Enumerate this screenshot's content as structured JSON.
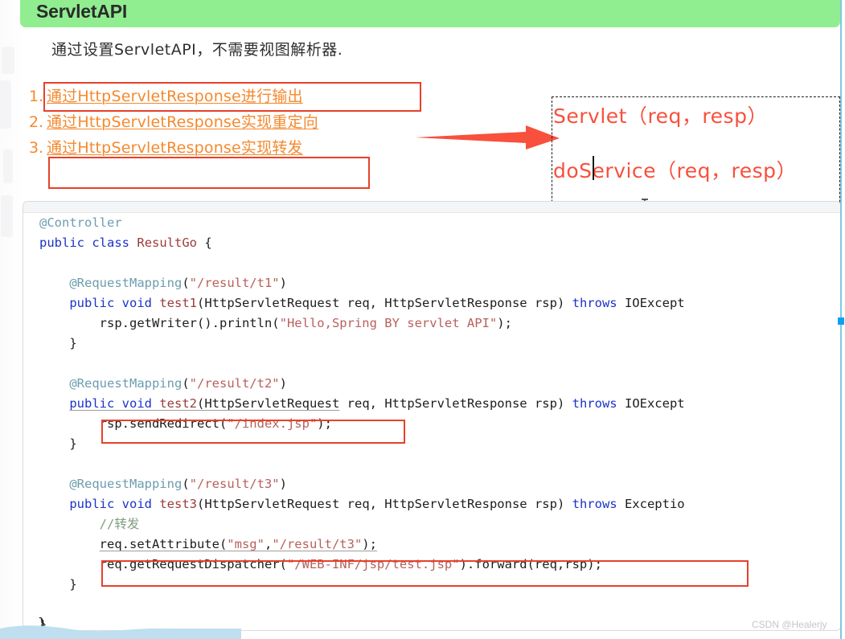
{
  "header": {
    "title": "ServletAPI",
    "banner_color": "#90ee90"
  },
  "intro": {
    "text": "通过设置ServletAPI，不需要视图解析器."
  },
  "list": {
    "accent_color": "#f5892e",
    "items": [
      {
        "number": "1.",
        "label": "通过HttpServletResponse进行输出",
        "highlighted": "true"
      },
      {
        "number": "2.",
        "label": "通过HttpServletResponse实现重定向",
        "highlighted": "false"
      },
      {
        "number": "3.",
        "label": "通过HttpServletResponse实现转发",
        "highlighted": "true"
      }
    ]
  },
  "annotation": {
    "arrow_color": "#f8503c",
    "box_border": "#1d1d1d",
    "text_color": "#f8503c",
    "lines": [
      "Servlet（req，resp）",
      "doService（req，resp）"
    ]
  },
  "code": {
    "language": "java",
    "lines": [
      "@Controller",
      "public class ResultGo {",
      "",
      "    @RequestMapping(\"/result/t1\")",
      "    public void test1(HttpServletRequest req, HttpServletResponse rsp) throws IOExcept",
      "        rsp.getWriter().println(\"Hello,Spring BY servlet API\");",
      "    }",
      "",
      "    @RequestMapping(\"/result/t2\")",
      "    public void test2(HttpServletRequest req, HttpServletResponse rsp) throws IOExcept",
      "        rsp.sendRedirect(\"/index.jsp\");",
      "    }",
      "",
      "    @RequestMapping(\"/result/t3\")",
      "    public void test3(HttpServletRequest req, HttpServletResponse rsp) throws Exceptio",
      "        //转发",
      "        req.setAttribute(\"msg\",\"/result/t3\");",
      "        req.getRequestDispatcher(\"/WEB-INF/jsp/test.jsp\").forward(req,rsp);",
      "    }",
      "",
      "}"
    ],
    "highlight_boxes": [
      "rsp.sendRedirect(\"/index.jsp\");",
      "req.getRequestDispatcher(\"/WEB-INF/jsp/test.jsp\").forward(req,rsp);"
    ],
    "outer_closing_brace": "}"
  },
  "watermark": {
    "text": "CSDN @Healerjy"
  },
  "guide": {
    "line_color": "#7ec8e3",
    "handle_color": "#10a0f0"
  }
}
